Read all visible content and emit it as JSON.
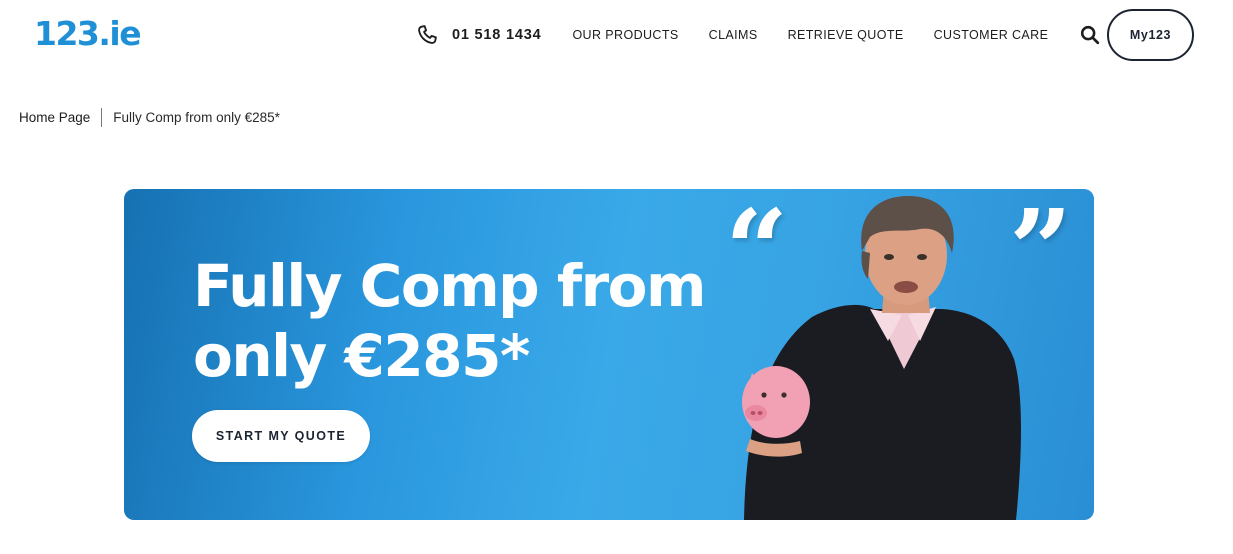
{
  "header": {
    "logo_text": "123.ie",
    "phone": "01 518 1434",
    "nav": [
      "OUR PRODUCTS",
      "CLAIMS",
      "RETRIEVE QUOTE",
      "CUSTOMER CARE"
    ],
    "account_button": "My123",
    "icons": {
      "phone": "phone-icon",
      "search": "search-icon"
    }
  },
  "breadcrumb": {
    "home": "Home Page",
    "current": "Fully Comp from only €285*"
  },
  "hero": {
    "title_line1": "Fully Comp from",
    "title_line2": "only €285*",
    "cta_label": "START MY QUOTE",
    "quote_open": "“",
    "quote_close": "”"
  },
  "colors": {
    "brand_blue": "#1f8fd6",
    "hero_blue": "#2a97de",
    "dark_navy": "#1c2433",
    "piggy_pink": "#f2a1b5"
  }
}
